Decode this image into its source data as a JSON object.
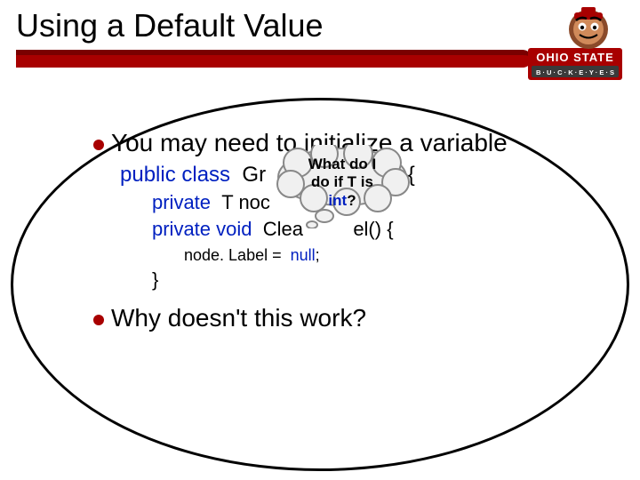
{
  "slide": {
    "title": "Using a Default Value",
    "logo": {
      "org": "OHIO STATE",
      "subtitle": "B · U · C · K · E · Y · E · S"
    },
    "bullets": {
      "b1": "You may need to initialize a variable",
      "b2": "Why doesn't this work?"
    },
    "code": {
      "l1_kw1": "public class",
      "l1_name_a": "Gr",
      "l1_name_b": "T> {",
      "l2_kw": "private",
      "l2_rest_a": "T noc",
      "l3_kw": "private void",
      "l3_rest": "Clea",
      "l3_tail": "el() {",
      "l4_a": "node. Label =",
      "l4_null": "null",
      "l4_semi": ";",
      "l5": "}"
    },
    "bubble": {
      "l1": "What do I",
      "l2": "do if T is",
      "l3": "int",
      "l3_tail": "?"
    }
  }
}
